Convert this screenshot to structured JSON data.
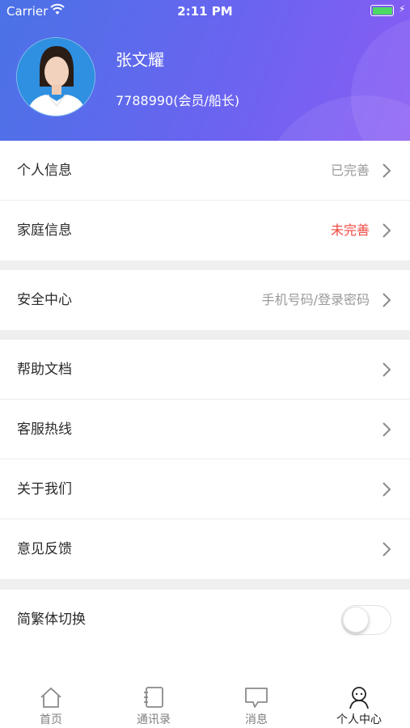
{
  "status_bar": {
    "carrier": "Carrier",
    "time": "2:11 PM"
  },
  "profile": {
    "name": "张文耀",
    "id_line": "7788990(会员/船长)"
  },
  "groups": [
    {
      "items": [
        {
          "label": "个人信息",
          "value": "已完善",
          "value_color": "gray"
        },
        {
          "label": "家庭信息",
          "value": "未完善",
          "value_color": "red"
        }
      ]
    },
    {
      "items": [
        {
          "label": "安全中心",
          "value": "手机号码/登录密码",
          "value_color": "gray"
        }
      ]
    },
    {
      "items": [
        {
          "label": "帮助文档",
          "value": ""
        },
        {
          "label": "客服热线",
          "value": ""
        },
        {
          "label": "关于我们",
          "value": ""
        },
        {
          "label": "意见反馈",
          "value": ""
        }
      ]
    },
    {
      "items": [
        {
          "label": "简繁体切换",
          "toggle": false
        }
      ]
    }
  ],
  "tabbar": [
    {
      "label": "首页",
      "icon": "home-icon",
      "active": false
    },
    {
      "label": "通讯录",
      "icon": "contacts-icon",
      "active": false
    },
    {
      "label": "消息",
      "icon": "message-icon",
      "active": false
    },
    {
      "label": "个人中心",
      "icon": "profile-icon",
      "active": true
    }
  ],
  "colors": {
    "accent_red": "#f0473e",
    "header_start": "#4a72e6",
    "header_end": "#8a5cf4",
    "battery": "#4cd964"
  }
}
